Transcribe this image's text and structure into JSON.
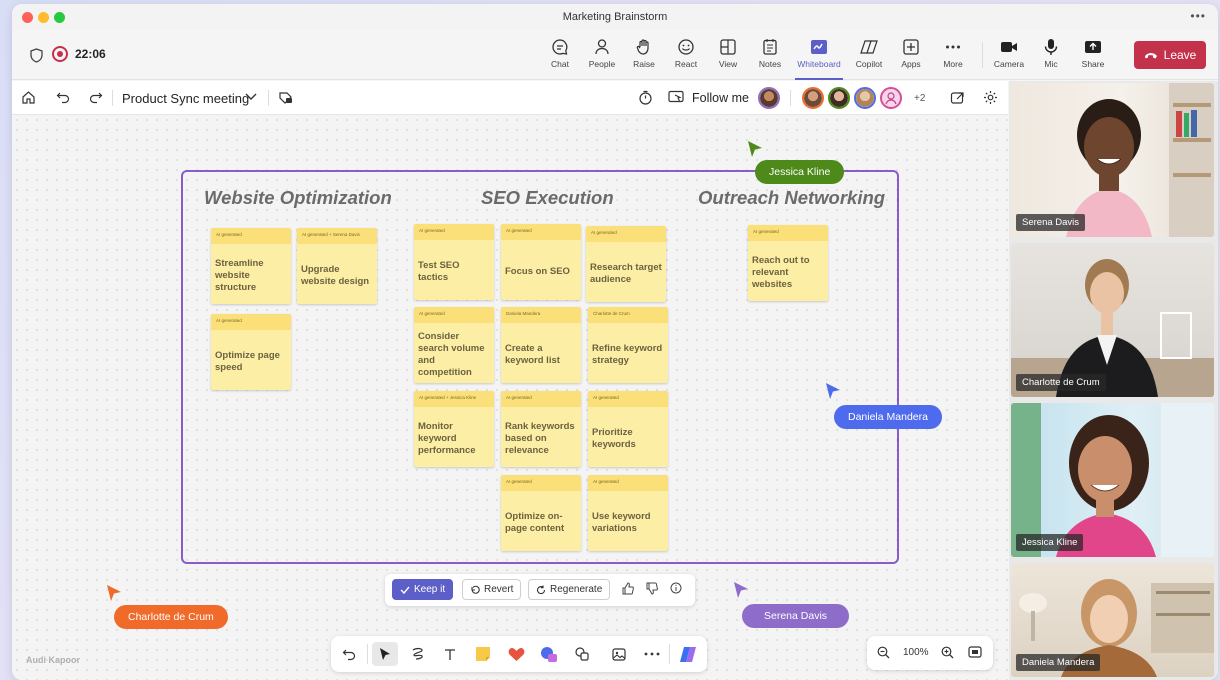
{
  "window": {
    "title": "Marketing Brainstorm"
  },
  "meeting": {
    "timer": "22:06",
    "tools": [
      {
        "label": "Chat",
        "icon": "chat-icon"
      },
      {
        "label": "People",
        "icon": "people-icon"
      },
      {
        "label": "Raise",
        "icon": "raise-hand-icon"
      },
      {
        "label": "React",
        "icon": "react-icon"
      },
      {
        "label": "View",
        "icon": "view-icon"
      },
      {
        "label": "Notes",
        "icon": "notes-icon"
      },
      {
        "label": "Whiteboard",
        "icon": "whiteboard-icon"
      },
      {
        "label": "Copilot",
        "icon": "copilot-icon"
      },
      {
        "label": "Apps",
        "icon": "apps-icon"
      },
      {
        "label": "More",
        "icon": "more-icon"
      }
    ],
    "media": [
      {
        "label": "Camera",
        "icon": "camera-icon"
      },
      {
        "label": "Mic",
        "icon": "mic-icon"
      },
      {
        "label": "Share",
        "icon": "share-icon"
      }
    ],
    "leave_label": "Leave",
    "accent": "#5b5fc7",
    "leave_color": "#c4314b"
  },
  "whiteboard": {
    "title": "Product Sync meeting",
    "follow_label": "Follow me",
    "extra_participants": "+2",
    "frame_color": "#8a5cc9",
    "columns": [
      {
        "heading": "Website Optimization"
      },
      {
        "heading": "SEO Execution"
      },
      {
        "heading": "Outreach Networking"
      }
    ],
    "notes": [
      {
        "tag": "AI generated",
        "text": "Streamline website structure"
      },
      {
        "tag": "AI generated + Serena Davis",
        "text": "Upgrade website design"
      },
      {
        "tag": "AI generated",
        "text": "Optimize page speed"
      },
      {
        "tag": "AI generated",
        "text": "Test SEO tactics"
      },
      {
        "tag": "AI generated",
        "text": "Focus on SEO"
      },
      {
        "tag": "AI generated",
        "text": "Research target audience"
      },
      {
        "tag": "AI generated",
        "text": "Consider search volume and competition"
      },
      {
        "tag": "Daniela Mandera",
        "text": "Create a keyword list"
      },
      {
        "tag": "Charlotte de Crum",
        "text": "Refine keyword strategy"
      },
      {
        "tag": "AI generated + Jessica Kline",
        "text": "Monitor keyword performance"
      },
      {
        "tag": "AI generated",
        "text": "Rank keywords based on relevance"
      },
      {
        "tag": "AI generated",
        "text": "Prioritize keywords"
      },
      {
        "tag": "AI generated",
        "text": "Optimize on-page content"
      },
      {
        "tag": "AI generated",
        "text": "Use keyword variations"
      },
      {
        "tag": "AI generated",
        "text": "Reach out to relevant websites"
      }
    ],
    "cursors": [
      {
        "name": "Jessica Kline",
        "color": "#4e8a1a"
      },
      {
        "name": "Daniela Mandera",
        "color": "#4f6bed"
      },
      {
        "name": "Charlotte de Crum",
        "color": "#f06b2a"
      },
      {
        "name": "Serena Davis",
        "color": "#8e6cc9"
      }
    ],
    "ai_actions": {
      "keep": "Keep it",
      "revert": "Revert",
      "regenerate": "Regenerate"
    },
    "zoom": "100%",
    "watermark": "Audi Kapoor"
  },
  "participants": [
    {
      "name": "Serena Davis"
    },
    {
      "name": "Charlotte de Crum"
    },
    {
      "name": "Jessica Kline"
    },
    {
      "name": "Daniela Mandera"
    }
  ]
}
